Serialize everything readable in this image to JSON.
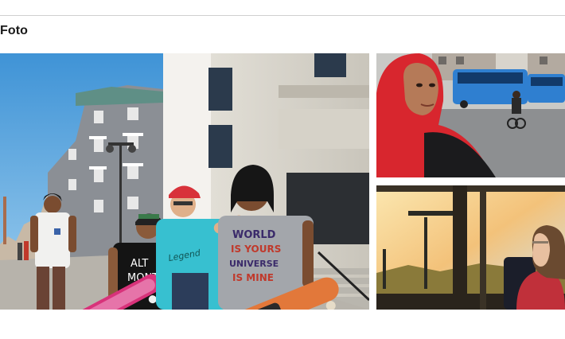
{
  "section": {
    "title": "Foto"
  },
  "photos": [
    {
      "label": "photo-skaters",
      "shirt_prints": [
        "ALT",
        "MONT",
        "WORLD",
        "IS YOURS",
        "UNIVERSE",
        "IS MINE"
      ]
    },
    {
      "label": "photo-hijab-street"
    },
    {
      "label": "photo-train-window"
    }
  ],
  "colors": {
    "rule": "#cfcfcf",
    "title": "#1a1a1a",
    "sky": "#5aa5dc",
    "scarf": "#d8262e",
    "bus": "#2f7fd0",
    "sunset": "#f3c27a"
  }
}
